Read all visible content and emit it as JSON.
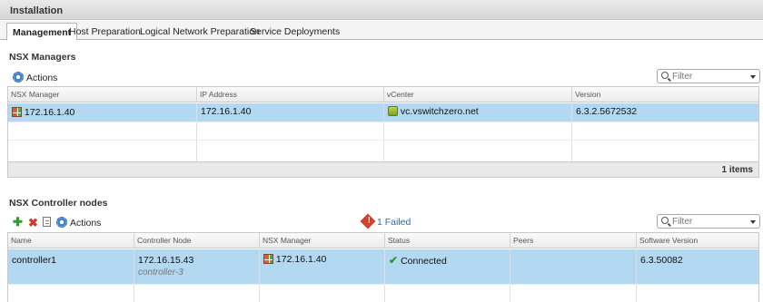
{
  "window": {
    "title": "Installation"
  },
  "tabs": [
    {
      "label": "Management"
    },
    {
      "label": "Host Preparation"
    },
    {
      "label": "Logical Network Preparation"
    },
    {
      "label": "Service Deployments"
    }
  ],
  "nsx_managers": {
    "title": "NSX Managers",
    "actions_label": "Actions",
    "filter_placeholder": "Filter",
    "columns": [
      "NSX Manager",
      "IP Address",
      "vCenter",
      "Version"
    ],
    "rows": [
      {
        "manager": "172.16.1.40",
        "ip": "172.16.1.40",
        "vcenter": "vc.vswitchzero.net",
        "version": "6.3.2.5672532"
      }
    ],
    "footer": "1 items"
  },
  "controllers": {
    "title": "NSX Controller nodes",
    "actions_label": "Actions",
    "failed_label": "1 Failed",
    "filter_placeholder": "Filter",
    "columns": [
      "Name",
      "Controller Node",
      "NSX Manager",
      "Status",
      "Peers",
      "Software Version"
    ],
    "rows": [
      {
        "name": "controller1",
        "node_ip": "172.16.15.43",
        "node_name": "controller-3",
        "manager": "172.16.1.40",
        "status": "Connected",
        "peers": "",
        "software_version": "6.3.50082"
      }
    ]
  },
  "icons": {
    "actions": "gear-icon",
    "manager": "nsx-manager-icon",
    "vcenter": "vcenter-icon",
    "add": "plus-icon",
    "delete": "x-icon",
    "details": "document-icon",
    "failed": "alert-icon",
    "connected": "check-icon"
  },
  "colors": {
    "selected_row": "#b3d9f2",
    "link": "#2a6cb0",
    "alert": "#d6402b",
    "ok": "#2f9a2f"
  }
}
